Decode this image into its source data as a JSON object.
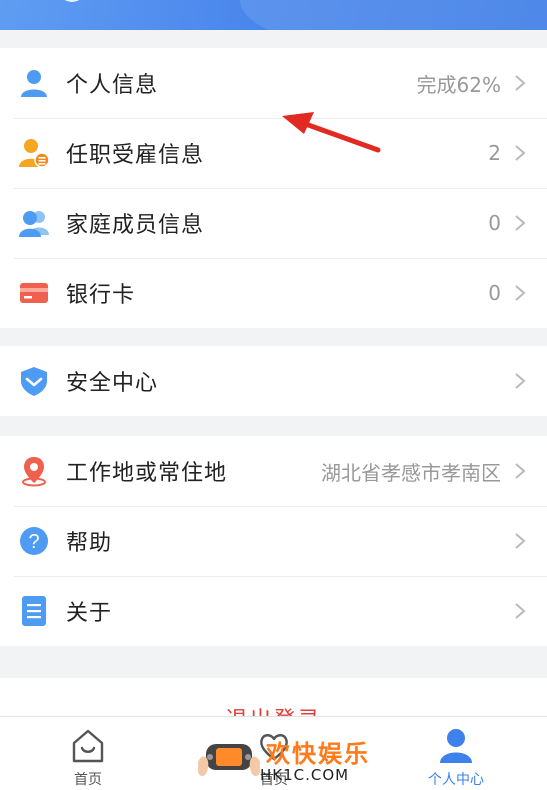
{
  "menu_groups": [
    {
      "items": [
        {
          "label": "个人信息",
          "value": "完成62%",
          "icon": "person-icon"
        },
        {
          "label": "任职受雇信息",
          "value": "2",
          "icon": "employment-icon"
        },
        {
          "label": "家庭成员信息",
          "value": "0",
          "icon": "family-icon"
        },
        {
          "label": "银行卡",
          "value": "0",
          "icon": "bank-card-icon"
        }
      ]
    },
    {
      "items": [
        {
          "label": "安全中心",
          "value": "",
          "icon": "shield-icon"
        }
      ]
    },
    {
      "items": [
        {
          "label": "工作地或常住地",
          "value": "湖北省孝感市孝南区",
          "icon": "location-pin-icon"
        },
        {
          "label": "帮助",
          "value": "",
          "icon": "help-icon"
        },
        {
          "label": "关于",
          "value": "",
          "icon": "document-icon"
        }
      ]
    }
  ],
  "logout_label": "退出登录",
  "tabbar": {
    "home": "首页",
    "middle": "首页",
    "profile": "个人中心"
  },
  "watermark": {
    "title": "欢快娱乐",
    "url": "HK1C.COM"
  },
  "colors": {
    "accent": "#3c82ea",
    "logout": "#e0403a",
    "watermark": "#ff7a1a"
  }
}
